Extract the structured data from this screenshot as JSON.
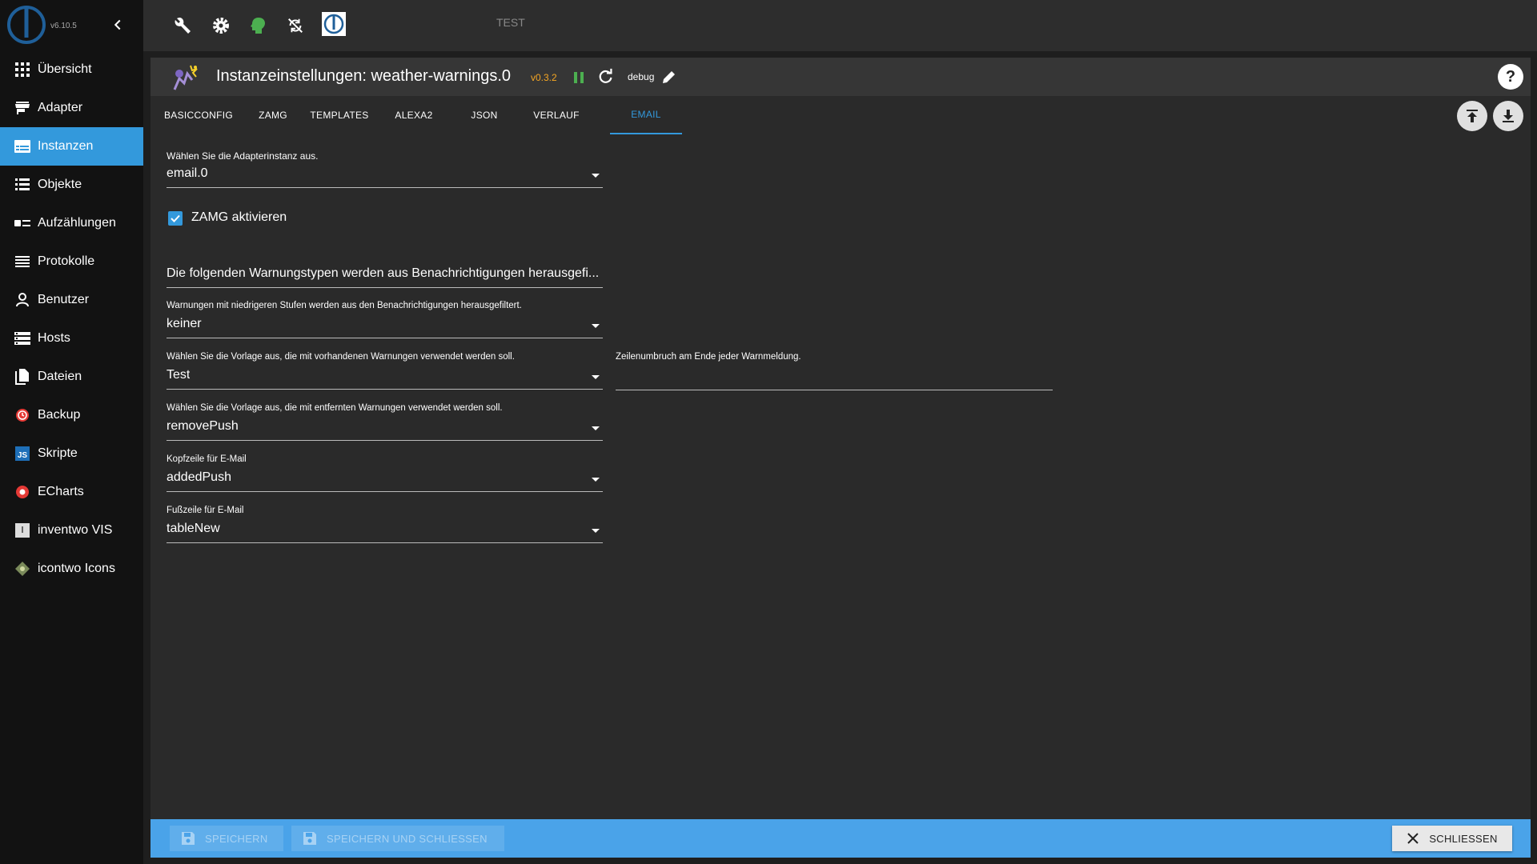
{
  "app": {
    "version": "v6.10.5",
    "host_label": "TEST"
  },
  "sidebar": {
    "items": [
      {
        "label": "Übersicht",
        "icon": "grid-icon",
        "active": false
      },
      {
        "label": "Adapter",
        "icon": "store-icon",
        "active": false
      },
      {
        "label": "Instanzen",
        "icon": "instances-icon",
        "active": true
      },
      {
        "label": "Objekte",
        "icon": "list-icon",
        "active": false
      },
      {
        "label": "Aufzählungen",
        "icon": "enum-icon",
        "active": false
      },
      {
        "label": "Protokolle",
        "icon": "log-icon",
        "active": false
      },
      {
        "label": "Benutzer",
        "icon": "user-icon",
        "active": false
      },
      {
        "label": "Hosts",
        "icon": "hosts-icon",
        "active": false
      },
      {
        "label": "Dateien",
        "icon": "files-icon",
        "active": false
      },
      {
        "label": "Backup",
        "icon": "backup-icon",
        "active": false
      },
      {
        "label": "Skripte",
        "icon": "js-icon",
        "active": false
      },
      {
        "label": "ECharts",
        "icon": "echarts-icon",
        "active": false
      },
      {
        "label": "inventwo VIS",
        "icon": "inventwo-icon",
        "active": false
      },
      {
        "label": "icontwo Icons",
        "icon": "icontwo-icon",
        "active": false
      }
    ]
  },
  "dialog": {
    "title": "Instanzeinstellungen: weather-warnings.0",
    "version": "v0.3.2",
    "loglevel": "debug",
    "help": "?"
  },
  "tabs": [
    "BASICCONFIG",
    "ZAMG",
    "TEMPLATES",
    "ALEXA2",
    "JSON",
    "VERLAUF",
    "EMAIL"
  ],
  "active_tab": "EMAIL",
  "form": {
    "instance_label": "Wählen Sie die Adapterinstanz aus.",
    "instance_value": "email.0",
    "zamg_checkbox_label": "ZAMG aktivieren",
    "zamg_checked": true,
    "filter_types_value": "Die folgenden Warnungstypen werden aus Benachrichtigungen herausgefi...",
    "level_label": "Warnungen mit niedrigeren Stufen werden aus den Benachrichtigungen herausgefiltert.",
    "level_value": "keiner",
    "template_existing_label": "Wählen Sie die Vorlage aus, die mit vorhandenen Warnungen verwendet werden soll.",
    "template_existing_value": "Test",
    "linebreak_label": "Zeilenumbruch am Ende jeder Warnmeldung.",
    "linebreak_value": "",
    "template_removed_label": "Wählen Sie die Vorlage aus, die mit entfernten Warnungen verwendet werden soll.",
    "template_removed_value": "removePush",
    "header_label": "Kopfzeile für E-Mail",
    "header_value": "addedPush",
    "footer_label": "Fußzeile für E-Mail",
    "footer_value": "tableNew"
  },
  "footer": {
    "save": "SPEICHERN",
    "save_close": "SPEICHERN UND SCHLIESSEN",
    "close": "SCHLIESSEN"
  },
  "colors": {
    "accent": "#3399dc",
    "footer_bg": "#4aa3e9",
    "version": "#f5a623",
    "run_indicator": "#4caf50"
  }
}
